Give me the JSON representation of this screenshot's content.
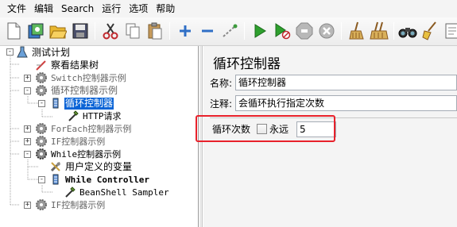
{
  "menu": [
    "文件",
    "编辑",
    "Search",
    "运行",
    "选项",
    "帮助"
  ],
  "toolbar": {
    "icons": [
      "new-icon",
      "templates-icon",
      "open-icon",
      "save-icon",
      "cut-icon",
      "copy-icon",
      "paste-icon",
      "expand-icon",
      "collapse-icon",
      "toggle-icon",
      "start-icon",
      "start-no-pause-icon",
      "stop-icon",
      "shutdown-icon",
      "clear-icon",
      "clear-all-icon",
      "search-icon",
      "reset-search-icon",
      "function-helper-icon"
    ]
  },
  "tree": {
    "items": [
      {
        "label": "测试计划"
      },
      {
        "label": "察看结果树"
      },
      {
        "label": "Switch控制器示例"
      },
      {
        "label": "循环控制器示例"
      },
      {
        "label": "循环控制器"
      },
      {
        "label": "HTTP请求"
      },
      {
        "label": "ForEach控制器示例"
      },
      {
        "label": "IF控制器示例"
      },
      {
        "label": "While控制器示例"
      },
      {
        "label": "用户定义的变量"
      },
      {
        "label": "While Controller"
      },
      {
        "label": "BeanShell Sampler"
      },
      {
        "label": "IF控制器示例"
      }
    ]
  },
  "panel": {
    "title": "循环控制器",
    "name_label": "名称:",
    "name_value": "循环控制器",
    "comment_label": "注释:",
    "comment_value": "会循环执行指定次数",
    "loop_label": "循环次数",
    "forever_label": "永远",
    "loop_value": "5"
  },
  "colors": {
    "selection": "#0a64d6",
    "highlight": "#e8212b"
  }
}
